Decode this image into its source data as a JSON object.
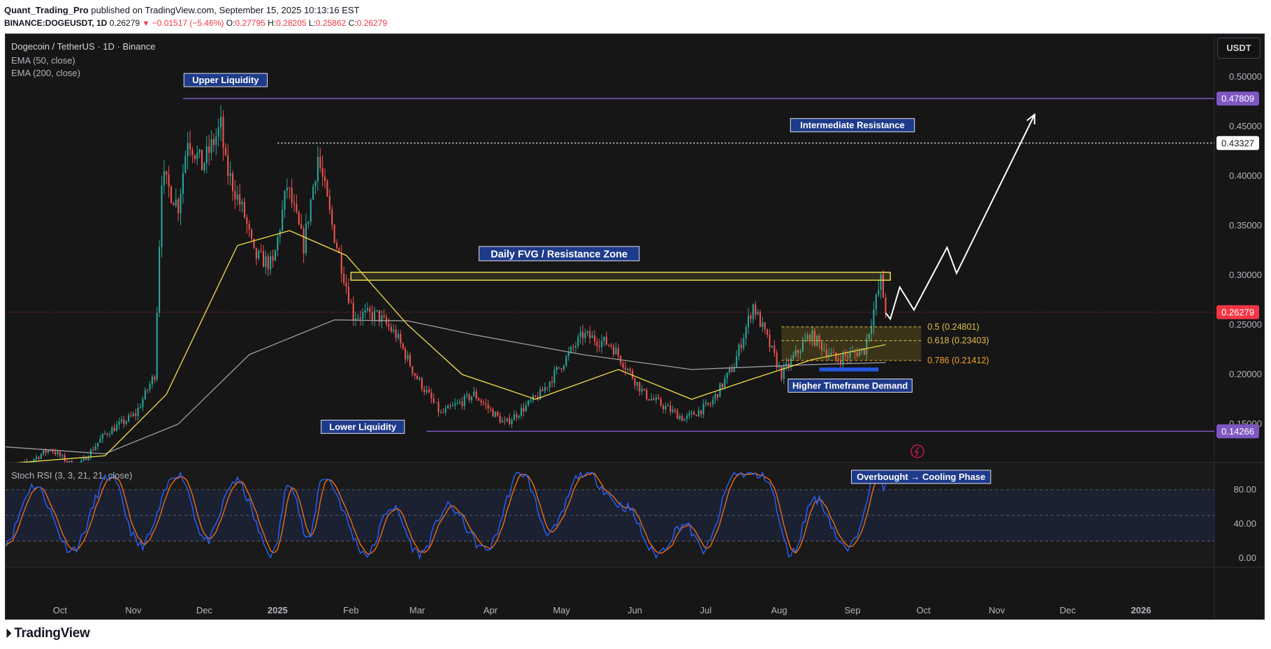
{
  "header": {
    "publisher": "Quant_Trading_Pro",
    "published_text": "published on TradingView.com, September 15, 2025 10:13:16 EST",
    "symbol": "BINANCE:DOGEUSDT, 1D",
    "last": "0.26279",
    "change": "−0.01517 (−5.46%)",
    "o_label": "O:",
    "o": "0.27795",
    "h_label": "H:",
    "h": "0.28205",
    "l_label": "L:",
    "l": "0.25862",
    "c_label": "C:",
    "c": "0.26279"
  },
  "legend": {
    "title": "Dogecoin / TetherUS · 1D · Binance",
    "ema50": "EMA (50, close)",
    "ema200": "EMA (200, close)",
    "stoch": "Stoch RSI (3, 3, 21, 21, close)"
  },
  "currency_button": "USDT",
  "footer": {
    "logo": "TradingView"
  },
  "colors": {
    "background": "#161616",
    "up": "#26a69a",
    "down": "#ef5350",
    "ema50": "#f2de4a",
    "ema200": "#9e9e9e",
    "liquidity": "#7e57c2",
    "fvg": "#e8d44d",
    "demand": "#2962ff",
    "stoch_k": "#2962ff",
    "stoch_d": "#ff6d00",
    "last_price": "#f23645"
  },
  "chart_data": {
    "type": "candlestick",
    "title": "Dogecoin / TetherUS · 1D · Binance",
    "y_axis": {
      "min": 0.13,
      "max": 0.51,
      "ticks": [
        "0.50000",
        "0.45000",
        "0.40000",
        "0.35000",
        "0.30000",
        "0.25000",
        "0.20000",
        "0.15000"
      ],
      "position": "right"
    },
    "x_axis": {
      "labels": [
        {
          "t": "2024-10-01",
          "label": "Oct"
        },
        {
          "t": "2024-11-01",
          "label": "Nov"
        },
        {
          "t": "2024-12-01",
          "label": "Dec"
        },
        {
          "t": "2025-01-01",
          "label": "2025"
        },
        {
          "t": "2025-02-01",
          "label": "Feb"
        },
        {
          "t": "2025-03-01",
          "label": "Mar"
        },
        {
          "t": "2025-04-01",
          "label": "Apr"
        },
        {
          "t": "2025-05-01",
          "label": "May"
        },
        {
          "t": "2025-06-01",
          "label": "Jun"
        },
        {
          "t": "2025-07-01",
          "label": "Jul"
        },
        {
          "t": "2025-08-01",
          "label": "Aug"
        },
        {
          "t": "2025-09-01",
          "label": "Sep"
        },
        {
          "t": "2025-10-01",
          "label": "Oct"
        },
        {
          "t": "2025-11-01",
          "label": "Nov"
        },
        {
          "t": "2025-12-01",
          "label": "Dec"
        },
        {
          "t": "2026-01-01",
          "label": "2026"
        }
      ],
      "range": [
        "2024-09-08",
        "2026-02-01"
      ]
    },
    "price_path": [
      {
        "t": "2024-09-08",
        "p": 0.098
      },
      {
        "t": "2024-09-27",
        "p": 0.125
      },
      {
        "t": "2024-10-08",
        "p": 0.105
      },
      {
        "t": "2024-10-20",
        "p": 0.14
      },
      {
        "t": "2024-11-02",
        "p": 0.16
      },
      {
        "t": "2024-11-10",
        "p": 0.2
      },
      {
        "t": "2024-11-13",
        "p": 0.4
      },
      {
        "t": "2024-11-20",
        "p": 0.37
      },
      {
        "t": "2024-11-24",
        "p": 0.44
      },
      {
        "t": "2024-11-30",
        "p": 0.41
      },
      {
        "t": "2024-12-08",
        "p": 0.45
      },
      {
        "t": "2024-12-10",
        "p": 0.41
      },
      {
        "t": "2024-12-18",
        "p": 0.36
      },
      {
        "t": "2024-12-22",
        "p": 0.32
      },
      {
        "t": "2024-12-30",
        "p": 0.31
      },
      {
        "t": "2025-01-05",
        "p": 0.39
      },
      {
        "t": "2025-01-12",
        "p": 0.33
      },
      {
        "t": "2025-01-18",
        "p": 0.42
      },
      {
        "t": "2025-01-24",
        "p": 0.35
      },
      {
        "t": "2025-02-02",
        "p": 0.26
      },
      {
        "t": "2025-02-12",
        "p": 0.26
      },
      {
        "t": "2025-02-20",
        "p": 0.24
      },
      {
        "t": "2025-02-28",
        "p": 0.2
      },
      {
        "t": "2025-03-11",
        "p": 0.16
      },
      {
        "t": "2025-03-25",
        "p": 0.18
      },
      {
        "t": "2025-04-07",
        "p": 0.15
      },
      {
        "t": "2025-04-22",
        "p": 0.18
      },
      {
        "t": "2025-05-10",
        "p": 0.24
      },
      {
        "t": "2025-05-22",
        "p": 0.23
      },
      {
        "t": "2025-06-05",
        "p": 0.18
      },
      {
        "t": "2025-06-22",
        "p": 0.155
      },
      {
        "t": "2025-07-03",
        "p": 0.17
      },
      {
        "t": "2025-07-13",
        "p": 0.21
      },
      {
        "t": "2025-07-21",
        "p": 0.27
      },
      {
        "t": "2025-08-02",
        "p": 0.2
      },
      {
        "t": "2025-08-14",
        "p": 0.24
      },
      {
        "t": "2025-08-25",
        "p": 0.215
      },
      {
        "t": "2025-09-06",
        "p": 0.225
      },
      {
        "t": "2025-09-13",
        "p": 0.295
      },
      {
        "t": "2025-09-15",
        "p": 0.26279
      }
    ],
    "ema50_path": [
      {
        "t": "2024-09-08",
        "p": 0.11
      },
      {
        "t": "2024-10-20",
        "p": 0.118
      },
      {
        "t": "2024-11-15",
        "p": 0.18
      },
      {
        "t": "2024-12-15",
        "p": 0.33
      },
      {
        "t": "2025-01-06",
        "p": 0.345
      },
      {
        "t": "2025-01-30",
        "p": 0.32
      },
      {
        "t": "2025-02-25",
        "p": 0.25
      },
      {
        "t": "2025-03-20",
        "p": 0.2
      },
      {
        "t": "2025-04-20",
        "p": 0.175
      },
      {
        "t": "2025-05-25",
        "p": 0.205
      },
      {
        "t": "2025-06-25",
        "p": 0.175
      },
      {
        "t": "2025-07-20",
        "p": 0.195
      },
      {
        "t": "2025-08-15",
        "p": 0.215
      },
      {
        "t": "2025-09-15",
        "p": 0.23
      }
    ],
    "ema200_path": [
      {
        "t": "2024-09-08",
        "p": 0.127
      },
      {
        "t": "2024-10-20",
        "p": 0.12
      },
      {
        "t": "2024-11-20",
        "p": 0.15
      },
      {
        "t": "2024-12-20",
        "p": 0.22
      },
      {
        "t": "2025-01-25",
        "p": 0.255
      },
      {
        "t": "2025-02-25",
        "p": 0.254
      },
      {
        "t": "2025-03-25",
        "p": 0.24
      },
      {
        "t": "2025-05-10",
        "p": 0.22
      },
      {
        "t": "2025-06-25",
        "p": 0.205
      },
      {
        "t": "2025-08-15",
        "p": 0.21
      },
      {
        "t": "2025-09-15",
        "p": 0.212
      }
    ],
    "projection": [
      {
        "t": "2025-09-15",
        "p": 0.262
      },
      {
        "t": "2025-09-17",
        "p": 0.256
      },
      {
        "t": "2025-09-21",
        "p": 0.288
      },
      {
        "t": "2025-09-27",
        "p": 0.265
      },
      {
        "t": "2025-10-11",
        "p": 0.328
      },
      {
        "t": "2025-10-15",
        "p": 0.302
      },
      {
        "t": "2025-11-17",
        "p": 0.462
      }
    ],
    "levels": [
      {
        "name": "Upper Liquidity",
        "value": 0.47809,
        "label": "0.47809",
        "from": "2024-11-22"
      },
      {
        "name": "Intermediate Resistance",
        "value": 0.43327,
        "label": "0.43327",
        "from": "2025-01-01"
      },
      {
        "name": "Lower Liquidity",
        "value": 0.14266,
        "label": "0.14266",
        "from": "2025-03-05"
      }
    ],
    "last_price": {
      "value": 0.26279,
      "label": "0.26279"
    },
    "zones": [
      {
        "name": "Daily FVG / Resistance Zone",
        "from": "2025-02-01",
        "to": "2025-09-17",
        "top": 0.303,
        "bottom": 0.295
      },
      {
        "name": "Higher Timeframe Demand",
        "from": "2025-08-18",
        "to": "2025-09-12",
        "top": 0.207,
        "bottom": 0.203
      }
    ],
    "fib": {
      "from": "2025-08-02",
      "to": "2025-09-30",
      "levels": [
        {
          "label": "0.5 (0.24801)",
          "value": 0.24801
        },
        {
          "label": "0.618 (0.23403)",
          "value": 0.23403
        },
        {
          "label": "0.786 (0.21412)",
          "value": 0.21412
        }
      ]
    },
    "annotations": [
      {
        "text": "Upper Liquidity",
        "t": "2024-12-10",
        "p": 0.495
      },
      {
        "text": "Intermediate Resistance",
        "t": "2025-09-01",
        "p": 0.4495
      },
      {
        "text": "Daily FVG / Resistance Zone",
        "t": "2025-04-30",
        "p": 0.3195
      },
      {
        "text": "Higher Timeframe Demand",
        "t": "2025-08-31",
        "p": 0.187
      },
      {
        "text": "Lower Liquidity",
        "t": "2025-02-06",
        "p": 0.1455
      }
    ],
    "stoch_rsi": {
      "title": "Stoch RSI (3, 3, 21, 21, close)",
      "y_axis": {
        "min": -20,
        "max": 120,
        "ticks": [
          "80.00",
          "40.00",
          "0.00"
        ]
      },
      "bands": [
        80,
        50,
        20
      ],
      "k_path": [
        {
          "t": "2024-09-08",
          "v": 20
        },
        {
          "t": "2024-09-20",
          "v": 85
        },
        {
          "t": "2024-10-06",
          "v": 10
        },
        {
          "t": "2024-10-22",
          "v": 95
        },
        {
          "t": "2024-11-04",
          "v": 15
        },
        {
          "t": "2024-11-20",
          "v": 100
        },
        {
          "t": "2024-12-02",
          "v": 20
        },
        {
          "t": "2024-12-14",
          "v": 90
        },
        {
          "t": "2024-12-30",
          "v": 5
        },
        {
          "t": "2025-01-06",
          "v": 90
        },
        {
          "t": "2025-01-14",
          "v": 20
        },
        {
          "t": "2025-01-20",
          "v": 95
        },
        {
          "t": "2025-02-08",
          "v": 5
        },
        {
          "t": "2025-02-18",
          "v": 60
        },
        {
          "t": "2025-03-02",
          "v": 5
        },
        {
          "t": "2025-03-14",
          "v": 60
        },
        {
          "t": "2025-03-30",
          "v": 10
        },
        {
          "t": "2025-04-14",
          "v": 100
        },
        {
          "t": "2025-04-26",
          "v": 30
        },
        {
          "t": "2025-05-10",
          "v": 100
        },
        {
          "t": "2025-05-28",
          "v": 60
        },
        {
          "t": "2025-06-10",
          "v": 5
        },
        {
          "t": "2025-06-22",
          "v": 40
        },
        {
          "t": "2025-06-30",
          "v": 10
        },
        {
          "t": "2025-07-14",
          "v": 100
        },
        {
          "t": "2025-07-26",
          "v": 95
        },
        {
          "t": "2025-08-06",
          "v": 5
        },
        {
          "t": "2025-08-16",
          "v": 70
        },
        {
          "t": "2025-08-30",
          "v": 10
        },
        {
          "t": "2025-09-12",
          "v": 100
        },
        {
          "t": "2025-09-15",
          "v": 80
        }
      ]
    },
    "stoch_annotation": {
      "text": "Overbought → Cooling Phase",
      "t": "2025-09-30",
      "v": 93
    }
  }
}
